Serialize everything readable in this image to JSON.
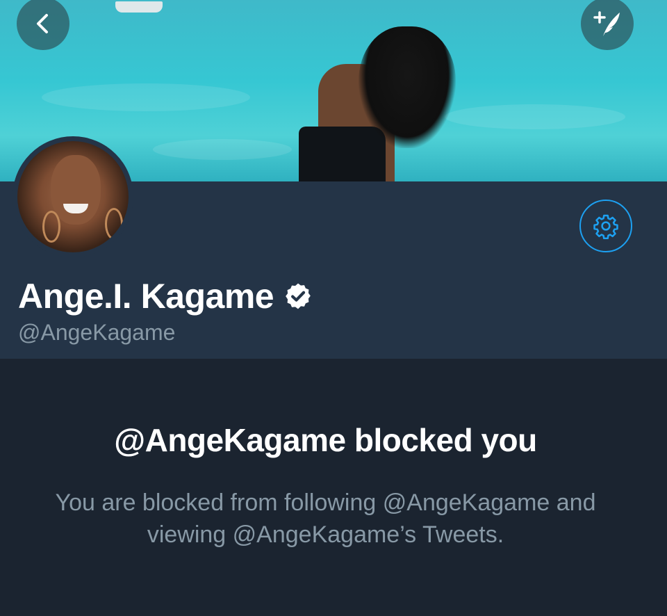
{
  "profile": {
    "display_name": "Ange.I. Kagame",
    "handle": "@AngeKagame",
    "verified": true
  },
  "icons": {
    "back": "chevron-left-icon",
    "compose": "compose-tweet-icon",
    "settings": "gear-icon",
    "verified": "verified-badge-icon"
  },
  "blocked": {
    "title": "@AngeKagame blocked you",
    "message": "You are blocked from following @AngeKagame and viewing @AngeKagame’s Tweets."
  },
  "colors": {
    "accent": "#1da1f2",
    "header_bg": "#243447",
    "page_bg": "#1b2430",
    "secondary_text": "#8899a6"
  }
}
